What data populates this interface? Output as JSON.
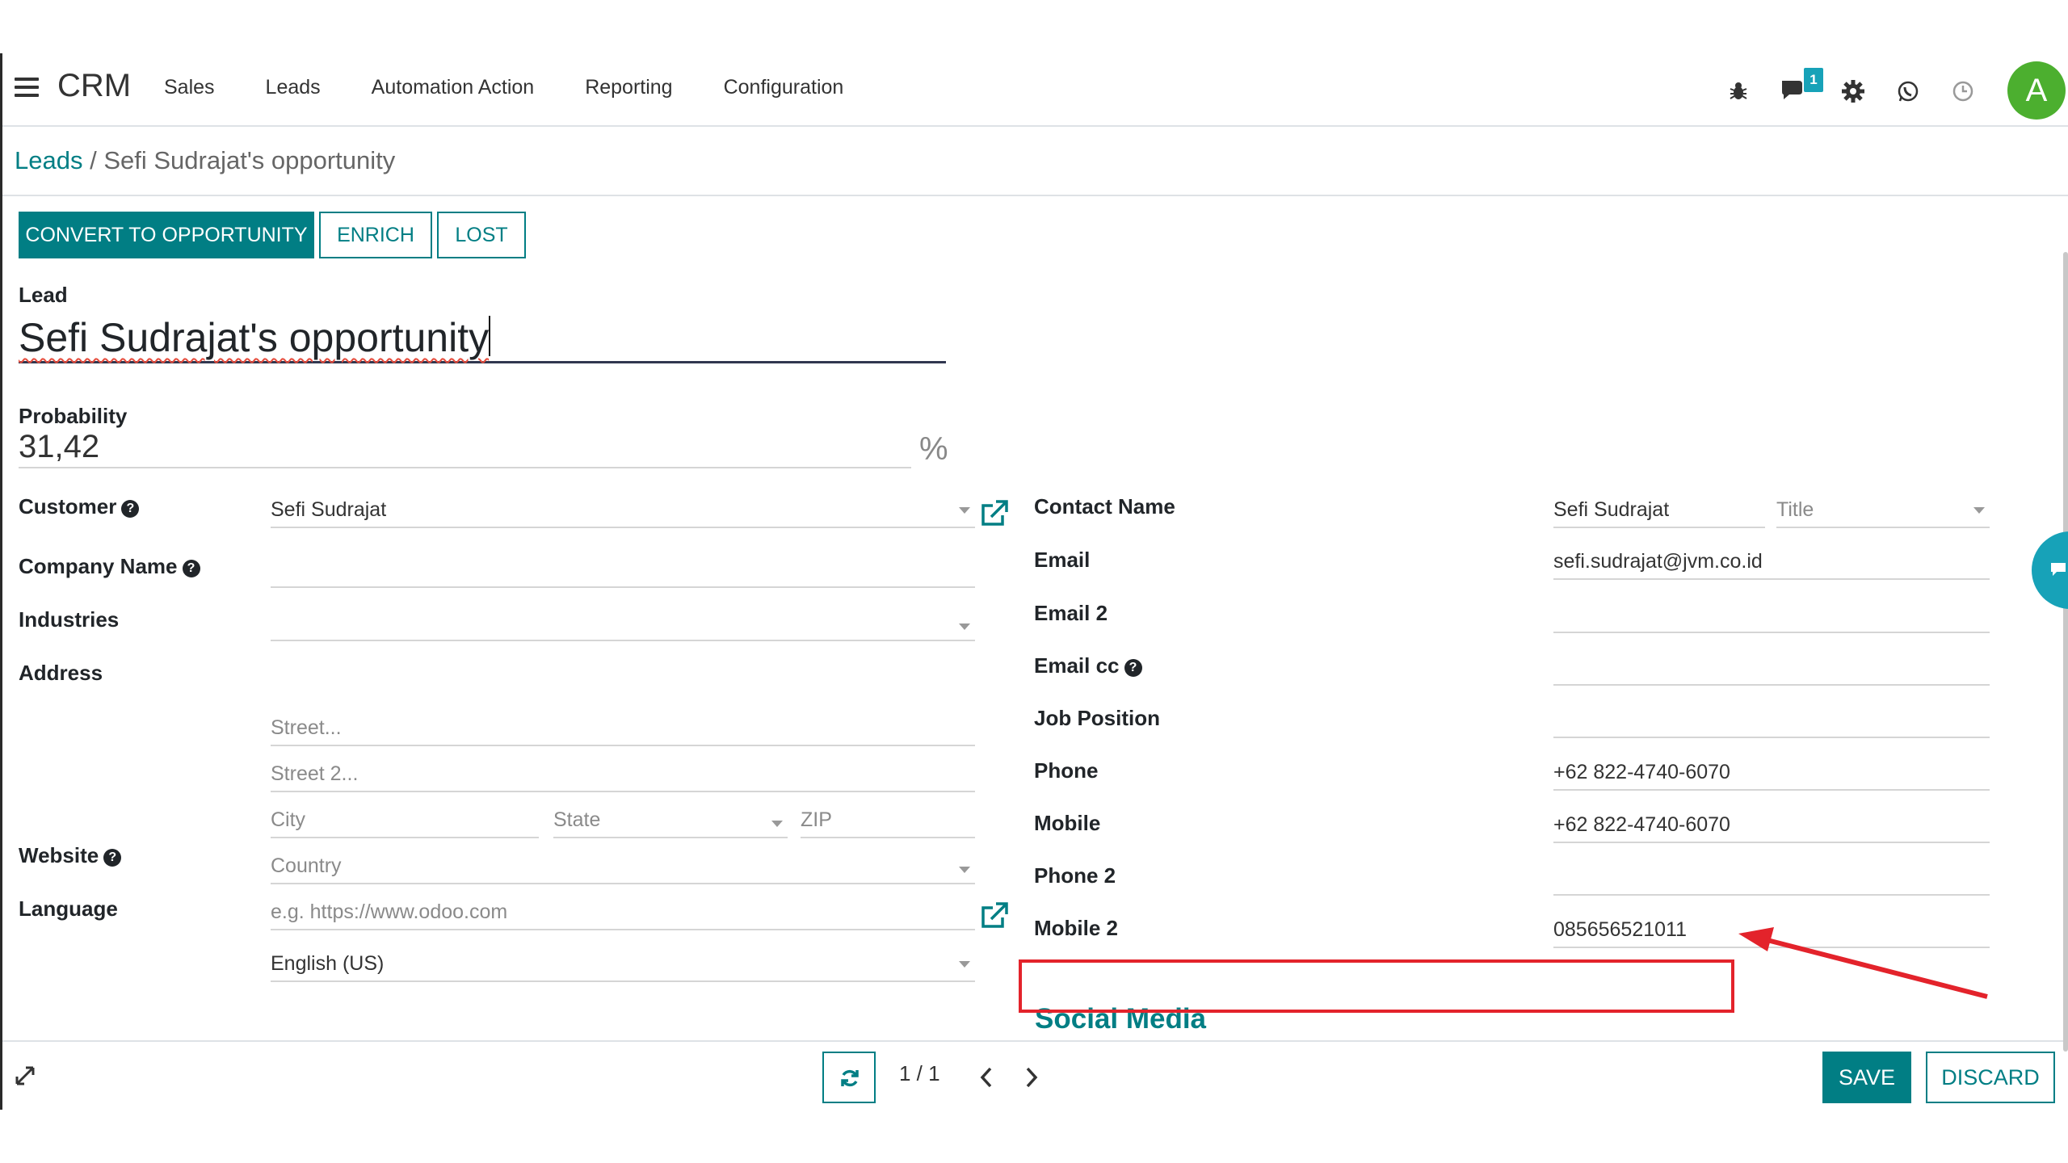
{
  "navbar": {
    "brand": "CRM",
    "menu": [
      "Sales",
      "Leads",
      "Automation Action",
      "Reporting",
      "Configuration"
    ],
    "notification_count": "1",
    "avatar_letter": "A",
    "icons": [
      "bug-icon",
      "chat-icon",
      "gear-icon",
      "whatsapp-icon",
      "clock-icon"
    ]
  },
  "breadcrumb": {
    "parent": "Leads",
    "separator": "/",
    "current": "Sefi Sudrajat's opportunity"
  },
  "statusbar": {
    "convert_label": "CONVERT TO OPPORTUNITY",
    "enrich_label": "ENRICH",
    "lost_label": "LOST"
  },
  "form": {
    "lead_label": "Lead",
    "lead_name": "Sefi Sudrajat's opportunity",
    "probability_label": "Probability",
    "probability_value": "31,42",
    "probability_unit": "%",
    "left": {
      "customer_label": "Customer",
      "customer_value": "Sefi Sudrajat",
      "company_name_label": "Company Name",
      "industries_label": "Industries",
      "address_label": "Address",
      "street_placeholder": "Street...",
      "street2_placeholder": "Street 2...",
      "city_placeholder": "City",
      "state_placeholder": "State",
      "zip_placeholder": "ZIP",
      "country_placeholder": "Country",
      "website_label": "Website",
      "website_placeholder": "e.g. https://www.odoo.com",
      "language_label": "Language",
      "language_value": "English (US)"
    },
    "right": {
      "contact_name_label": "Contact Name",
      "contact_name_value": "Sefi Sudrajat",
      "title_placeholder": "Title",
      "email_label": "Email",
      "email_value": "sefi.sudrajat@jvm.co.id",
      "email2_label": "Email 2",
      "email_cc_label": "Email cc",
      "job_position_label": "Job Position",
      "phone_label": "Phone",
      "phone_value": "+62 822-4740-6070",
      "mobile_label": "Mobile",
      "mobile_value": "+62 822-4740-6070",
      "phone2_label": "Phone 2",
      "mobile2_label": "Mobile 2",
      "mobile2_value": "085656521011"
    },
    "social_media_title": "Social Media"
  },
  "bottombar": {
    "pager": "1 / 1",
    "save_label": "SAVE",
    "discard_label": "DISCARD"
  },
  "colors": {
    "primary": "#017e84",
    "annotation": "#e3232b",
    "avatar": "#4caf2f",
    "badge": "#17a2b8"
  }
}
